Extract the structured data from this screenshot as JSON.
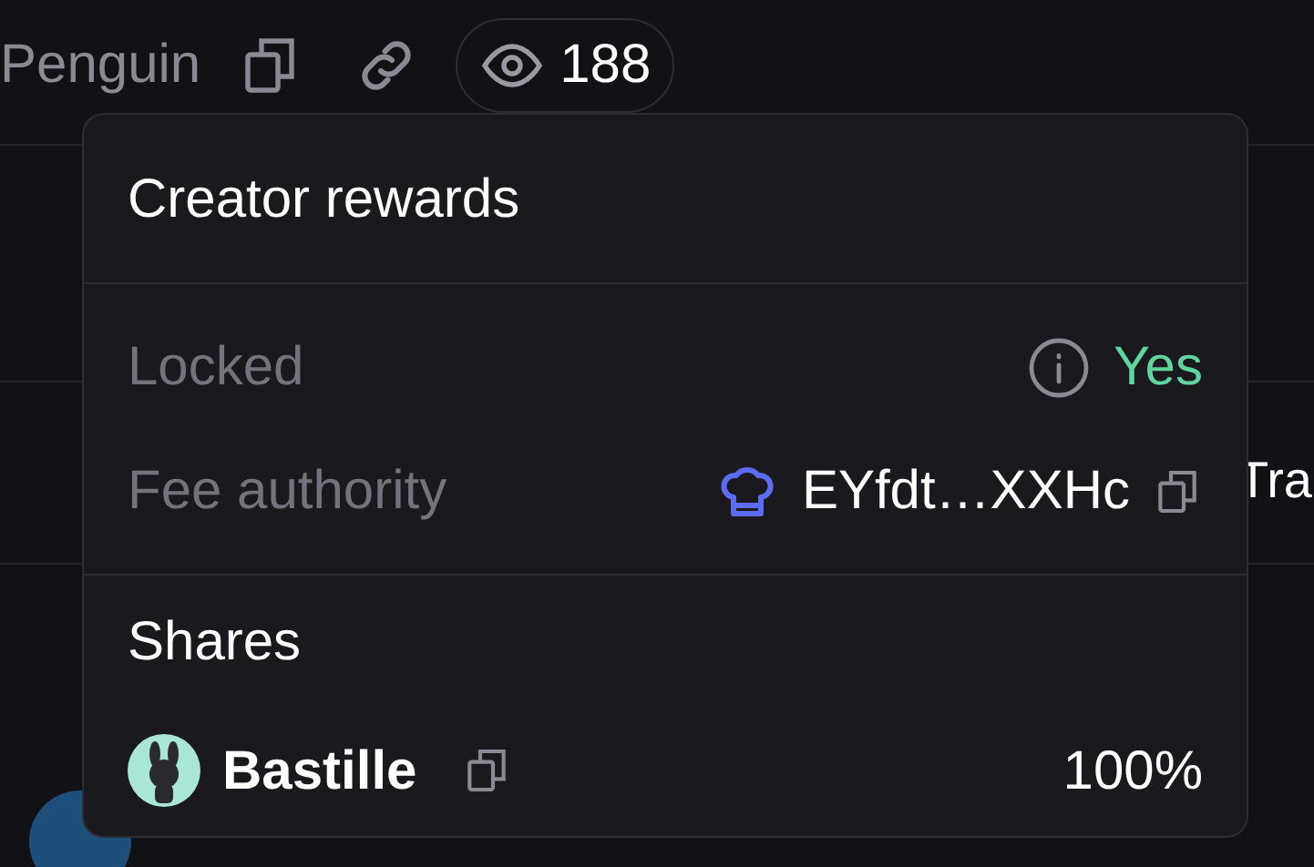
{
  "header": {
    "name": "Penguin",
    "views": "188"
  },
  "popover": {
    "title": "Creator rewards",
    "rows": [
      {
        "kind": "status",
        "label": "Locked",
        "value": "Yes"
      },
      {
        "kind": "address",
        "label": "Fee authority",
        "value": "EYfdt…XXHc"
      }
    ],
    "shares_title": "Shares",
    "shares": [
      {
        "name": "Bastille",
        "percent": "100%"
      }
    ]
  },
  "background_text": "Tra"
}
